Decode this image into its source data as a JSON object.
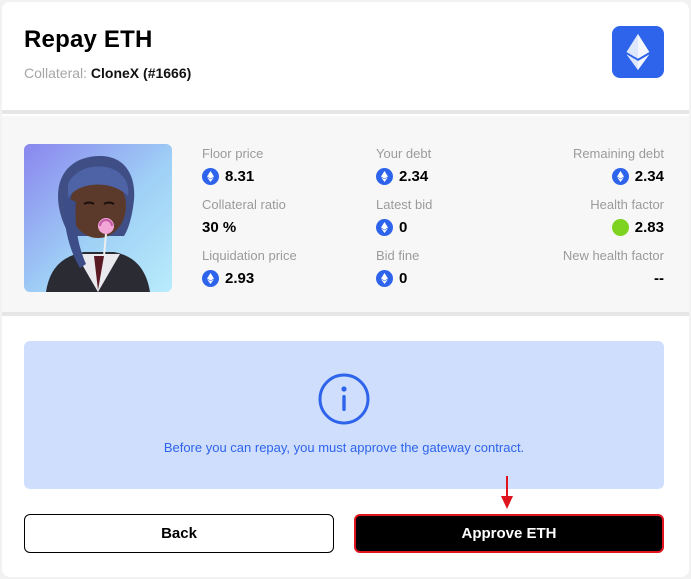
{
  "header": {
    "title": "Repay ETH",
    "collateral_label": "Collateral:",
    "collateral_value": "CloneX (#1666)",
    "token_icon": "ethereum-icon"
  },
  "stats": {
    "floor_price": {
      "label": "Floor price",
      "value": "8.31"
    },
    "your_debt": {
      "label": "Your debt",
      "value": "2.34"
    },
    "remaining_debt": {
      "label": "Remaining debt",
      "value": "2.34"
    },
    "collateral_ratio": {
      "label": "Collateral ratio",
      "value": "30 %"
    },
    "latest_bid": {
      "label": "Latest bid",
      "value": "0"
    },
    "health_factor": {
      "label": "Health factor",
      "value": "2.83",
      "status_color": "#7ed321"
    },
    "liquidation_price": {
      "label": "Liquidation price",
      "value": "2.93"
    },
    "bid_fine": {
      "label": "Bid fine",
      "value": "0"
    },
    "new_health_factor": {
      "label": "New health factor",
      "value": "--"
    }
  },
  "notice": {
    "icon": "info-icon",
    "text": "Before you can repay, you must approve the gateway contract."
  },
  "buttons": {
    "back": "Back",
    "approve": "Approve ETH"
  },
  "colors": {
    "accent": "#2e64ec",
    "notice_bg": "#cfdefc",
    "highlight": "#e0141e"
  }
}
